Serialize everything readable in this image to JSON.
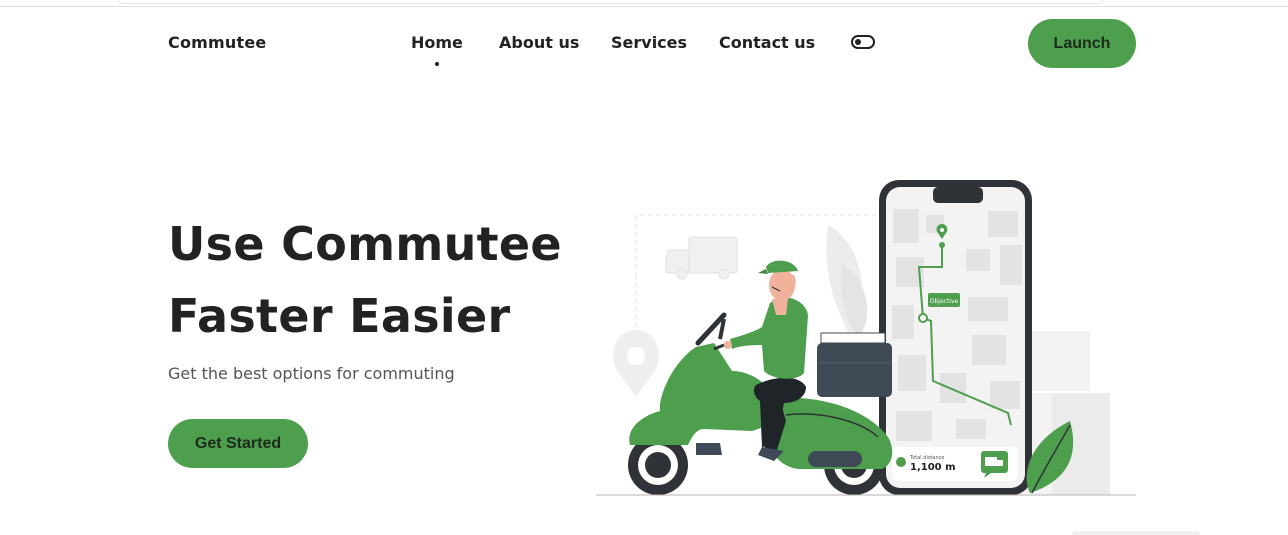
{
  "header": {
    "logo": "Commutee",
    "nav": [
      {
        "label": "Home",
        "active": true
      },
      {
        "label": "About us",
        "active": false
      },
      {
        "label": "Services",
        "active": false
      },
      {
        "label": "Contact us",
        "active": false
      }
    ],
    "theme_toggle_icon": "toggle-icon",
    "launch_label": "Launch"
  },
  "hero": {
    "title_line1": "Use Commutee",
    "title_line2": "Faster Easier",
    "subtitle": "Get the best options for commuting",
    "cta_label": "Get Started"
  },
  "illustration": {
    "map_badge": "Objective",
    "distance_label": "Total distance",
    "distance_value": "1,100 m"
  },
  "colors": {
    "accent": "#4e9f4d",
    "text": "#222222",
    "muted": "#555555"
  }
}
